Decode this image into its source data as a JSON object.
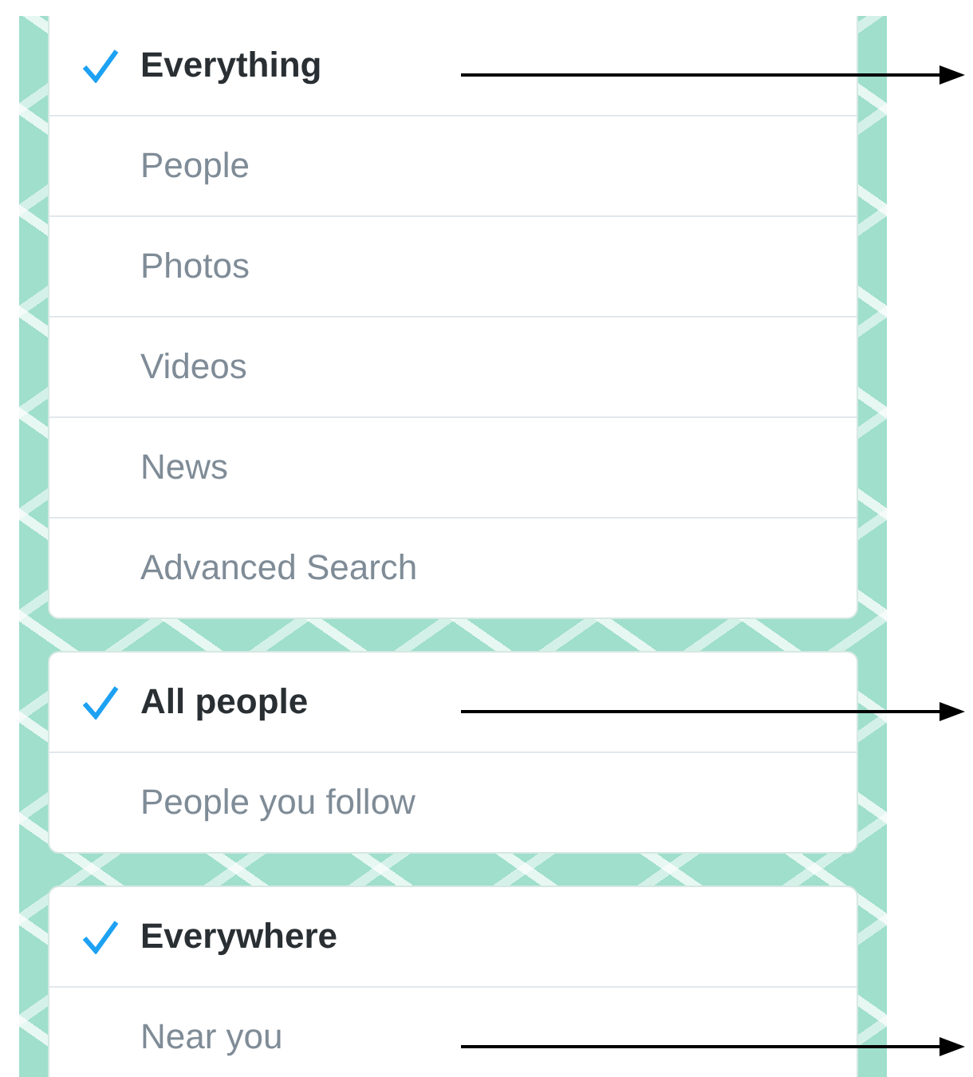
{
  "groups": [
    {
      "items": [
        {
          "label": "Everything",
          "selected": true,
          "arrow": true
        },
        {
          "label": "People",
          "selected": false,
          "arrow": false
        },
        {
          "label": "Photos",
          "selected": false,
          "arrow": false
        },
        {
          "label": "Videos",
          "selected": false,
          "arrow": false
        },
        {
          "label": "News",
          "selected": false,
          "arrow": false
        },
        {
          "label": "Advanced Search",
          "selected": false,
          "arrow": false
        }
      ]
    },
    {
      "items": [
        {
          "label": "All people",
          "selected": true,
          "arrow": true
        },
        {
          "label": "People you follow",
          "selected": false,
          "arrow": false
        }
      ]
    },
    {
      "items": [
        {
          "label": "Everywhere",
          "selected": true,
          "arrow": false
        },
        {
          "label": "Near you",
          "selected": false,
          "arrow": true
        }
      ]
    }
  ]
}
